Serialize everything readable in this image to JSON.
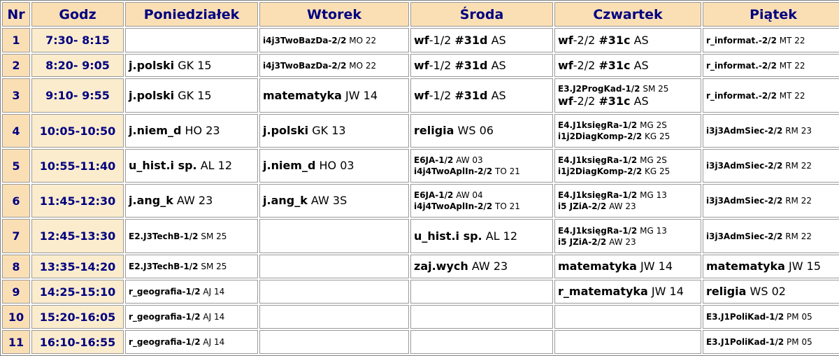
{
  "headers": [
    "Nr",
    "Godz",
    "Poniedziałek",
    "Wtorek",
    "Środa",
    "Czwartek",
    "Piątek"
  ],
  "rows": [
    {
      "nr": "1",
      "godz": "7:30- 8:15",
      "cells": [
        [],
        [
          {
            "size": "sm",
            "parts": [
              {
                "t": "i4j3TwoBazDa-2/2",
                "b": true
              },
              {
                "t": " MO 22",
                "b": false
              }
            ]
          }
        ],
        [
          {
            "size": "big",
            "parts": [
              {
                "t": "wf",
                "b": true
              },
              {
                "t": "-1/2 ",
                "b": false
              },
              {
                "t": "#31d",
                "b": true
              },
              {
                "t": " AS",
                "b": false
              }
            ]
          }
        ],
        [
          {
            "size": "big",
            "parts": [
              {
                "t": "wf",
                "b": true
              },
              {
                "t": "-2/2 ",
                "b": false
              },
              {
                "t": "#31c",
                "b": true
              },
              {
                "t": " AS",
                "b": false
              }
            ]
          }
        ],
        [
          {
            "size": "sm",
            "parts": [
              {
                "t": "r_informat.-2/2",
                "b": true
              },
              {
                "t": " MT 22",
                "b": false
              }
            ]
          }
        ]
      ]
    },
    {
      "nr": "2",
      "godz": "8:20- 9:05",
      "cells": [
        [
          {
            "size": "big",
            "parts": [
              {
                "t": "j.polski",
                "b": true
              },
              {
                "t": " GK 15",
                "b": false
              }
            ]
          }
        ],
        [
          {
            "size": "sm",
            "parts": [
              {
                "t": "i4j3TwoBazDa-2/2",
                "b": true
              },
              {
                "t": " MO 22",
                "b": false
              }
            ]
          }
        ],
        [
          {
            "size": "big",
            "parts": [
              {
                "t": "wf",
                "b": true
              },
              {
                "t": "-1/2 ",
                "b": false
              },
              {
                "t": "#31d",
                "b": true
              },
              {
                "t": " AS",
                "b": false
              }
            ]
          }
        ],
        [
          {
            "size": "big",
            "parts": [
              {
                "t": "wf",
                "b": true
              },
              {
                "t": "-2/2 ",
                "b": false
              },
              {
                "t": "#31c",
                "b": true
              },
              {
                "t": " AS",
                "b": false
              }
            ]
          }
        ],
        [
          {
            "size": "sm",
            "parts": [
              {
                "t": "r_informat.-2/2",
                "b": true
              },
              {
                "t": " MT 22",
                "b": false
              }
            ]
          }
        ]
      ]
    },
    {
      "nr": "3",
      "godz": "9:10- 9:55",
      "cells": [
        [
          {
            "size": "big",
            "parts": [
              {
                "t": "j.polski",
                "b": true
              },
              {
                "t": " GK 15",
                "b": false
              }
            ]
          }
        ],
        [
          {
            "size": "big",
            "parts": [
              {
                "t": "matematyka",
                "b": true
              },
              {
                "t": " JW 14",
                "b": false
              }
            ]
          }
        ],
        [
          {
            "size": "big",
            "parts": [
              {
                "t": "wf",
                "b": true
              },
              {
                "t": "-1/2 ",
                "b": false
              },
              {
                "t": "#31d",
                "b": true
              },
              {
                "t": " AS",
                "b": false
              }
            ]
          }
        ],
        [
          {
            "size": "sm",
            "parts": [
              {
                "t": "E3.J2ProgKad-1/2",
                "b": true
              },
              {
                "t": " SM 25",
                "b": false
              }
            ]
          },
          {
            "size": "big",
            "parts": [
              {
                "t": "wf",
                "b": true
              },
              {
                "t": "-2/2 ",
                "b": false
              },
              {
                "t": "#31c",
                "b": true
              },
              {
                "t": " AS",
                "b": false
              }
            ]
          }
        ],
        [
          {
            "size": "sm",
            "parts": [
              {
                "t": "r_informat.-2/2",
                "b": true
              },
              {
                "t": " MT 22",
                "b": false
              }
            ]
          }
        ]
      ]
    },
    {
      "nr": "4",
      "godz": "10:05-10:50",
      "cells": [
        [
          {
            "size": "big",
            "parts": [
              {
                "t": "j.niem_d",
                "b": true
              },
              {
                "t": " HO 23",
                "b": false
              }
            ]
          }
        ],
        [
          {
            "size": "big",
            "parts": [
              {
                "t": "j.polski",
                "b": true
              },
              {
                "t": " GK 13",
                "b": false
              }
            ]
          }
        ],
        [
          {
            "size": "big",
            "parts": [
              {
                "t": "religia",
                "b": true
              },
              {
                "t": " WS 06",
                "b": false
              }
            ]
          }
        ],
        [
          {
            "size": "sm",
            "parts": [
              {
                "t": "E4.J1księgRa-1/2",
                "b": true
              },
              {
                "t": " MG 2S",
                "b": false
              }
            ]
          },
          {
            "size": "sm",
            "parts": [
              {
                "t": "i1j2DiagKomp-2/2",
                "b": true
              },
              {
                "t": " KG 25",
                "b": false
              }
            ]
          }
        ],
        [
          {
            "size": "sm",
            "parts": [
              {
                "t": "i3j3AdmSiec-2/2",
                "b": true
              },
              {
                "t": " RM 23",
                "b": false
              }
            ]
          }
        ]
      ]
    },
    {
      "nr": "5",
      "godz": "10:55-11:40",
      "cells": [
        [
          {
            "size": "big",
            "parts": [
              {
                "t": "u_hist.i sp.",
                "b": true
              },
              {
                "t": " AL 12",
                "b": false
              }
            ]
          }
        ],
        [
          {
            "size": "big",
            "parts": [
              {
                "t": "j.niem_d",
                "b": true
              },
              {
                "t": " HO 03",
                "b": false
              }
            ]
          }
        ],
        [
          {
            "size": "sm",
            "parts": [
              {
                "t": "E6JA-1/2",
                "b": true
              },
              {
                "t": " AW 03",
                "b": false
              }
            ]
          },
          {
            "size": "sm",
            "parts": [
              {
                "t": "i4j4TwoAplIn-2/2",
                "b": true
              },
              {
                "t": " TO 21",
                "b": false
              }
            ]
          }
        ],
        [
          {
            "size": "sm",
            "parts": [
              {
                "t": "E4.J1księgRa-1/2",
                "b": true
              },
              {
                "t": " MG 2S",
                "b": false
              }
            ]
          },
          {
            "size": "sm",
            "parts": [
              {
                "t": "i1j2DiagKomp-2/2",
                "b": true
              },
              {
                "t": " KG 25",
                "b": false
              }
            ]
          }
        ],
        [
          {
            "size": "sm",
            "parts": [
              {
                "t": "i3j3AdmSiec-2/2",
                "b": true
              },
              {
                "t": " RM 22",
                "b": false
              }
            ]
          }
        ]
      ]
    },
    {
      "nr": "6",
      "godz": "11:45-12:30",
      "cells": [
        [
          {
            "size": "big",
            "parts": [
              {
                "t": "j.ang_k",
                "b": true
              },
              {
                "t": " AW 23",
                "b": false
              }
            ]
          }
        ],
        [
          {
            "size": "big",
            "parts": [
              {
                "t": "j.ang_k",
                "b": true
              },
              {
                "t": " AW 3S",
                "b": false
              }
            ]
          }
        ],
        [
          {
            "size": "sm",
            "parts": [
              {
                "t": "E6JA-1/2",
                "b": true
              },
              {
                "t": " AW 04",
                "b": false
              }
            ]
          },
          {
            "size": "sm",
            "parts": [
              {
                "t": "i4j4TwoAplIn-2/2",
                "b": true
              },
              {
                "t": " TO 21",
                "b": false
              }
            ]
          }
        ],
        [
          {
            "size": "sm",
            "parts": [
              {
                "t": "E4.J1księgRa-1/2",
                "b": true
              },
              {
                "t": " MG 13",
                "b": false
              }
            ]
          },
          {
            "size": "sm",
            "parts": [
              {
                "t": "i5 JZiA-2/2",
                "b": true
              },
              {
                "t": " AW 23",
                "b": false
              }
            ]
          }
        ],
        [
          {
            "size": "sm",
            "parts": [
              {
                "t": "i3j3AdmSiec-2/2",
                "b": true
              },
              {
                "t": " RM 22",
                "b": false
              }
            ]
          }
        ]
      ]
    },
    {
      "nr": "7",
      "godz": "12:45-13:30",
      "cells": [
        [
          {
            "size": "sm",
            "parts": [
              {
                "t": "E2.J3TechB-1/2",
                "b": true
              },
              {
                "t": " SM 25",
                "b": false
              }
            ]
          }
        ],
        [],
        [
          {
            "size": "big",
            "parts": [
              {
                "t": "u_hist.i sp.",
                "b": true
              },
              {
                "t": " AL 12",
                "b": false
              }
            ]
          }
        ],
        [
          {
            "size": "sm",
            "parts": [
              {
                "t": "E4.J1księgRa-1/2",
                "b": true
              },
              {
                "t": " MG 13",
                "b": false
              }
            ]
          },
          {
            "size": "sm",
            "parts": [
              {
                "t": "i5 JZiA-2/2",
                "b": true
              },
              {
                "t": " AW 23",
                "b": false
              }
            ]
          }
        ],
        [
          {
            "size": "sm",
            "parts": [
              {
                "t": "i3j3AdmSiec-2/2",
                "b": true
              },
              {
                "t": " RM 22",
                "b": false
              }
            ]
          }
        ]
      ]
    },
    {
      "nr": "8",
      "godz": "13:35-14:20",
      "cells": [
        [
          {
            "size": "sm",
            "parts": [
              {
                "t": "E2.J3TechB-1/2",
                "b": true
              },
              {
                "t": " SM 25",
                "b": false
              }
            ]
          }
        ],
        [],
        [
          {
            "size": "big",
            "parts": [
              {
                "t": "zaj.wych",
                "b": true
              },
              {
                "t": " AW 23",
                "b": false
              }
            ]
          }
        ],
        [
          {
            "size": "big",
            "parts": [
              {
                "t": "matematyka",
                "b": true
              },
              {
                "t": " JW 14",
                "b": false
              }
            ]
          }
        ],
        [
          {
            "size": "big",
            "parts": [
              {
                "t": "matematyka",
                "b": true
              },
              {
                "t": " JW 15",
                "b": false
              }
            ]
          }
        ]
      ]
    },
    {
      "nr": "9",
      "godz": "14:25-15:10",
      "cells": [
        [
          {
            "size": "sm",
            "parts": [
              {
                "t": "r_geografia-1/2",
                "b": true
              },
              {
                "t": " AJ 14",
                "b": false
              }
            ]
          }
        ],
        [],
        [],
        [
          {
            "size": "big",
            "parts": [
              {
                "t": "r_matematyka",
                "b": true
              },
              {
                "t": " JW 14",
                "b": false
              }
            ]
          }
        ],
        [
          {
            "size": "big",
            "parts": [
              {
                "t": "religia",
                "b": true
              },
              {
                "t": " WS 02",
                "b": false
              }
            ]
          }
        ]
      ]
    },
    {
      "nr": "10",
      "godz": "15:20-16:05",
      "cells": [
        [
          {
            "size": "sm",
            "parts": [
              {
                "t": "r_geografia-1/2",
                "b": true
              },
              {
                "t": " AJ 14",
                "b": false
              }
            ]
          }
        ],
        [],
        [],
        [],
        [
          {
            "size": "sm",
            "parts": [
              {
                "t": "E3.J1PoliKad-1/2",
                "b": true
              },
              {
                "t": " PM 05",
                "b": false
              }
            ]
          }
        ]
      ]
    },
    {
      "nr": "11",
      "godz": "16:10-16:55",
      "cells": [
        [
          {
            "size": "sm",
            "parts": [
              {
                "t": "r_geografia-1/2",
                "b": true
              },
              {
                "t": " AJ 14",
                "b": false
              }
            ]
          }
        ],
        [],
        [],
        [],
        [
          {
            "size": "sm",
            "parts": [
              {
                "t": "E3.J1PoliKad-1/2",
                "b": true
              },
              {
                "t": " PM 05",
                "b": false
              }
            ]
          }
        ]
      ]
    }
  ]
}
